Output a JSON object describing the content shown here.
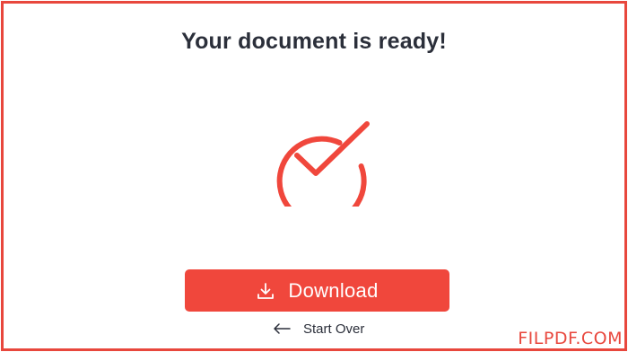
{
  "page": {
    "title": "Your document is ready!"
  },
  "status": {
    "icon": "checkmark-circle-icon"
  },
  "actions": {
    "download_label": "Download",
    "download_icon": "download-icon",
    "start_over_label": "Start Over",
    "start_over_icon": "arrow-left-icon"
  },
  "watermark": {
    "text": "FILPDF.COM"
  },
  "colors": {
    "accent": "#f0473c",
    "border": "#e8473d",
    "text_dark": "#2b2f3a",
    "background": "#ffffff"
  }
}
